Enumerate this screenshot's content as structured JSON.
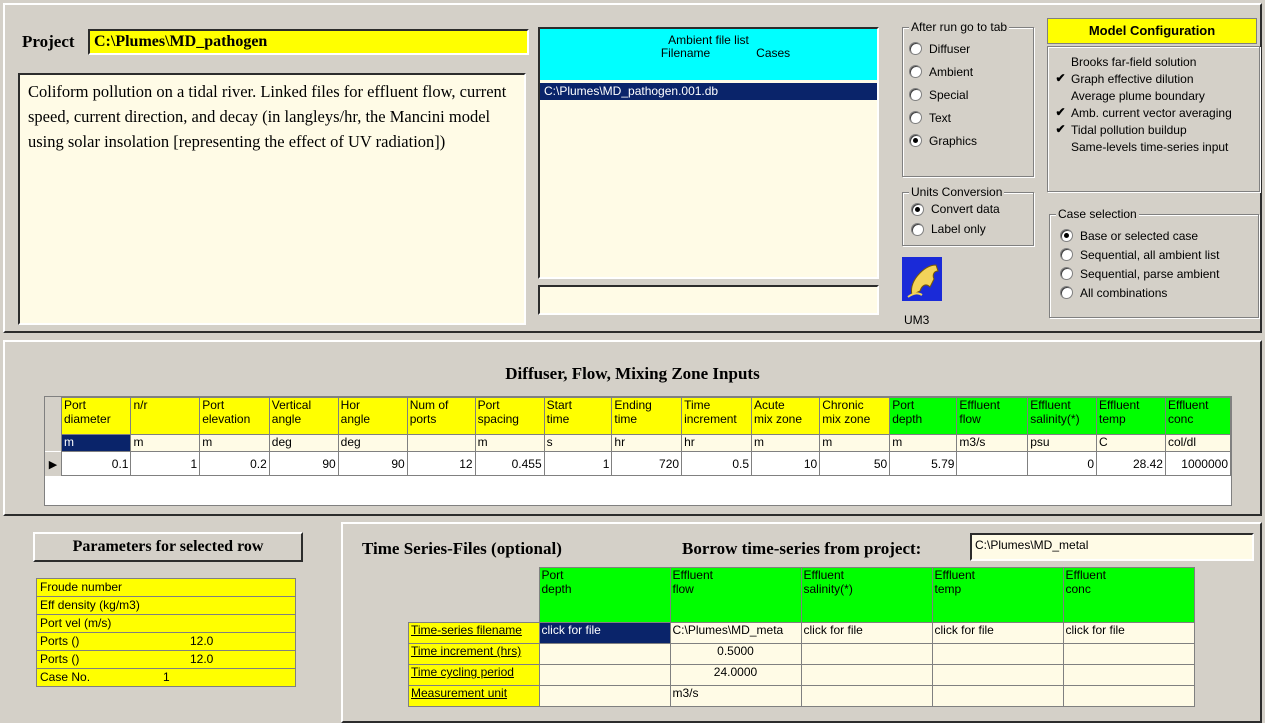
{
  "project": {
    "label": "Project",
    "path": "C:\\Plumes\\MD_pathogen",
    "description": "Coliform pollution on a tidal river. Linked files for effluent flow, current speed, current direction, and decay (in langleys/hr, the Mancini model using solar insolation [representing the effect of UV radiation])"
  },
  "ambient": {
    "title": "Ambient file list",
    "col_filename": "Filename",
    "col_cases": "Cases",
    "files": [
      "C:\\Plumes\\MD_pathogen.001.db"
    ],
    "bottom_field": ""
  },
  "after_run": {
    "title": "After run go to tab",
    "options": [
      "Diffuser",
      "Ambient",
      "Special",
      "Text",
      "Graphics"
    ],
    "selected": 4
  },
  "units": {
    "title": "Units Conversion",
    "options": [
      "Convert data",
      "Label only"
    ],
    "selected": 0
  },
  "model_icon_label": "UM3",
  "model_config": {
    "title": "Model Configuration",
    "items": [
      {
        "label": "Brooks far-field solution",
        "checked": false
      },
      {
        "label": "Graph effective dilution",
        "checked": true
      },
      {
        "label": "Average plume boundary",
        "checked": false
      },
      {
        "label": "Amb. current vector averaging",
        "checked": true
      },
      {
        "label": "Tidal pollution buildup",
        "checked": true
      },
      {
        "label": "Same-levels time-series input",
        "checked": false
      }
    ]
  },
  "case_selection": {
    "title": "Case selection",
    "options": [
      "Base or selected case",
      "Sequential, all ambient list",
      "Sequential, parse ambient",
      "All combinations"
    ],
    "selected": 0
  },
  "diffuser": {
    "title": "Diffuser, Flow, Mixing Zone Inputs",
    "headers": [
      [
        "Port",
        "diameter"
      ],
      [
        "n/r",
        ""
      ],
      [
        "Port",
        "elevation"
      ],
      [
        "Vertical",
        "angle"
      ],
      [
        "Hor",
        "angle"
      ],
      [
        "Num of",
        "ports"
      ],
      [
        "Port",
        "spacing"
      ],
      [
        "Start",
        "time"
      ],
      [
        "Ending",
        "time"
      ],
      [
        "Time",
        "increment"
      ],
      [
        "Acute",
        "mix zone"
      ],
      [
        "Chronic",
        "mix zone"
      ],
      [
        "Port",
        "depth"
      ],
      [
        "Effluent",
        "flow"
      ],
      [
        "Effluent",
        "salinity(*)"
      ],
      [
        "Effluent",
        "temp"
      ],
      [
        "Effluent",
        "conc"
      ]
    ],
    "header_colors": [
      "y",
      "y",
      "y",
      "y",
      "y",
      "y",
      "y",
      "y",
      "y",
      "y",
      "y",
      "y",
      "g",
      "g",
      "g",
      "g",
      "g"
    ],
    "units": [
      "m",
      "m",
      "m",
      "deg",
      "deg",
      "",
      "m",
      "s",
      "hr",
      "hr",
      "m",
      "m",
      "m",
      "m3/s",
      "psu",
      "C",
      "col/dl"
    ],
    "values": [
      "0.1",
      "1",
      "0.2",
      "90",
      "90",
      "12",
      "0.455",
      "1",
      "720",
      "0.5",
      "10",
      "50",
      "5.79",
      "",
      "0",
      "28.42",
      "1000000"
    ]
  },
  "params": {
    "title": "Parameters for selected row",
    "rows": [
      {
        "label": "Froude number",
        "value": ""
      },
      {
        "label": "Eff density (kg/m3)",
        "value": ""
      },
      {
        "label": "Port vel (m/s)",
        "value": ""
      },
      {
        "label": "Ports ()",
        "value": "12.0"
      },
      {
        "label": "Ports ()",
        "value": "12.0"
      },
      {
        "label": "Case No.",
        "value": "1"
      }
    ]
  },
  "timeseries": {
    "title": "Time Series-Files (optional)",
    "borrow_label": "Borrow time-series from project:",
    "borrow_value": "C:\\Plumes\\MD_metal",
    "col_headers": [
      [
        "Port",
        "depth"
      ],
      [
        "Effluent",
        "flow"
      ],
      [
        "Effluent",
        "salinity(*)"
      ],
      [
        "Effluent",
        "temp"
      ],
      [
        "Effluent",
        "conc"
      ]
    ],
    "row_labels": [
      "Time-series filename",
      "Time increment (hrs)",
      "Time cycling period",
      "Measurement unit"
    ],
    "cells": [
      [
        "click for file",
        "C:\\Plumes\\MD_meta",
        "click for file",
        "click for file",
        "click for file"
      ],
      [
        "",
        "0.5000",
        "",
        "",
        ""
      ],
      [
        "",
        "24.0000",
        "",
        "",
        ""
      ],
      [
        "",
        "m3/s",
        "",
        "",
        ""
      ]
    ]
  }
}
